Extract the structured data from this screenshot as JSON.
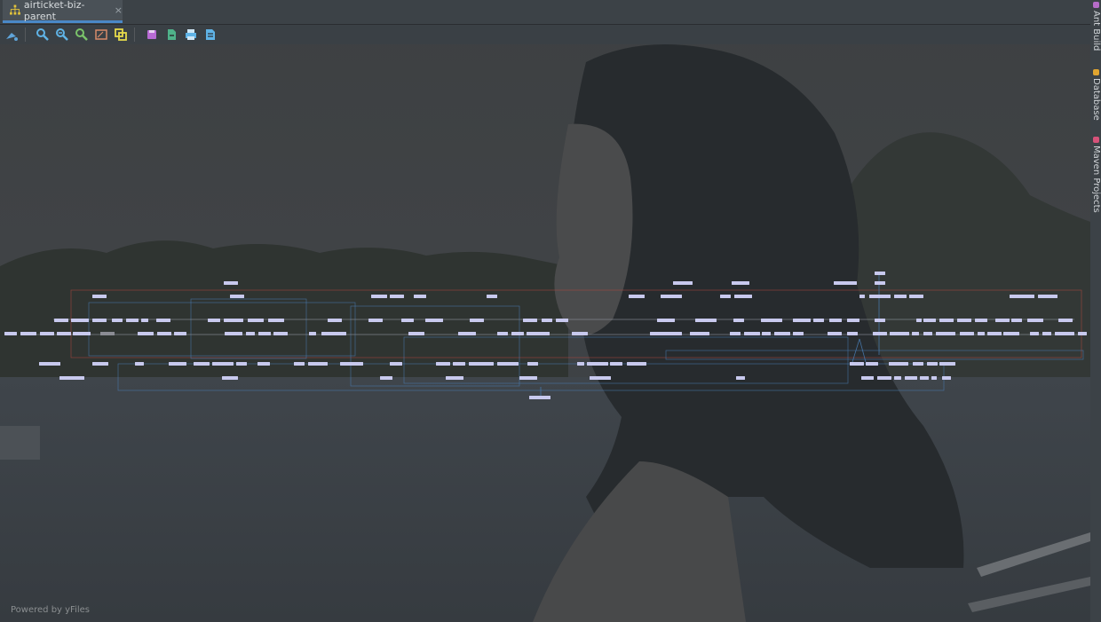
{
  "editor": {
    "tab": {
      "title": "airticket-biz-parent",
      "close_glyph": "×",
      "icon": "module-hierarchy-icon"
    }
  },
  "toolbar": {
    "buttons": [
      {
        "name": "fit-content-button",
        "icon": "layout-icon"
      },
      {
        "name": "zoom-in-button",
        "icon": "zoom-in-icon"
      },
      {
        "name": "zoom-out-button",
        "icon": "zoom-out-icon"
      },
      {
        "name": "actual-size-button",
        "icon": "zoom-actual-icon"
      },
      {
        "name": "fit-screen-button",
        "icon": "fit-screen-icon"
      },
      {
        "name": "copy-button",
        "icon": "copy-icon"
      },
      {
        "name": "save-button",
        "icon": "save-icon"
      },
      {
        "name": "export-button",
        "icon": "export-icon"
      },
      {
        "name": "print-button",
        "icon": "print-icon"
      },
      {
        "name": "print-preview-button",
        "icon": "print-preview-icon"
      }
    ]
  },
  "right_panel": {
    "items": [
      {
        "label": "Ant Build",
        "icon": "ant-icon",
        "color": "#b66cc8"
      },
      {
        "label": "Database",
        "icon": "database-icon",
        "color": "#e0a530"
      },
      {
        "label": "Maven Projects",
        "icon": "maven-icon",
        "color": "#d6527a"
      }
    ]
  },
  "diagram": {
    "footer_text": "Powered by yFiles",
    "node_color": "#c8c9ee",
    "edge_colors": {
      "blue": "#4a7fb8",
      "red": "#b5473f",
      "gray": "#8a8f98"
    }
  }
}
